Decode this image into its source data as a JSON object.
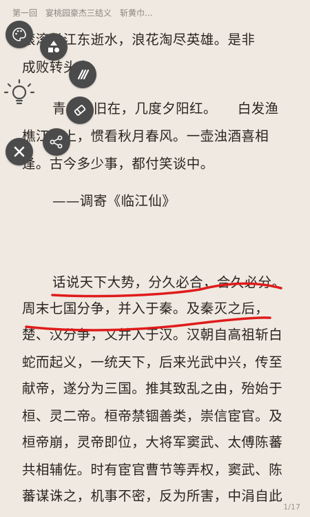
{
  "header": {
    "chapter_title": "第一回　宴桃园豪杰三结义　斩黄巾..."
  },
  "text": {
    "lines": [
      "滚滚长江东逝水，浪花淘尽英雄。是非",
      "成败转头空。",
      "青山依旧在，几度夕阳红。　　白发渔",
      "樵江渚上，惯看秋月春风。一壶浊酒喜相",
      "逢。古今多少事，都付笑谈中。",
      "——调寄《临江仙》",
      "话说天下大势，分久必合，合久必分。",
      "周末七国分争，并入于秦。及秦灭之后，",
      "楚、汉分争，又并入于汉。汉朝自高祖斩白",
      "蛇而起义，一统天下，后来光武中兴，传至",
      "献帝，遂分为三国。推其致乱之由，殆始于",
      "桓、灵二帝。桓帝禁锢善类，崇信宦官。及",
      "桓帝崩，灵帝即位，大将军窦武、太傅陈蕃",
      "共相辅佐。时有宦官曹节等弄权，窦武、陈",
      "蕃谋诛之，机事不密，反为所害，中涓自此"
    ]
  },
  "footer": {
    "page_indicator": "1/17"
  },
  "tools": [
    {
      "icon": "palette-icon"
    },
    {
      "icon": "shapes-icon"
    },
    {
      "icon": "pen-strokes-icon"
    },
    {
      "icon": "brightness-bulb-icon"
    },
    {
      "icon": "eraser-icon"
    },
    {
      "icon": "close-icon"
    },
    {
      "icon": "share-icon"
    }
  ],
  "colors": {
    "background": "#efe9e1",
    "tool_button": "#4b4b4b",
    "annotation_stroke": "#e01b1b"
  }
}
